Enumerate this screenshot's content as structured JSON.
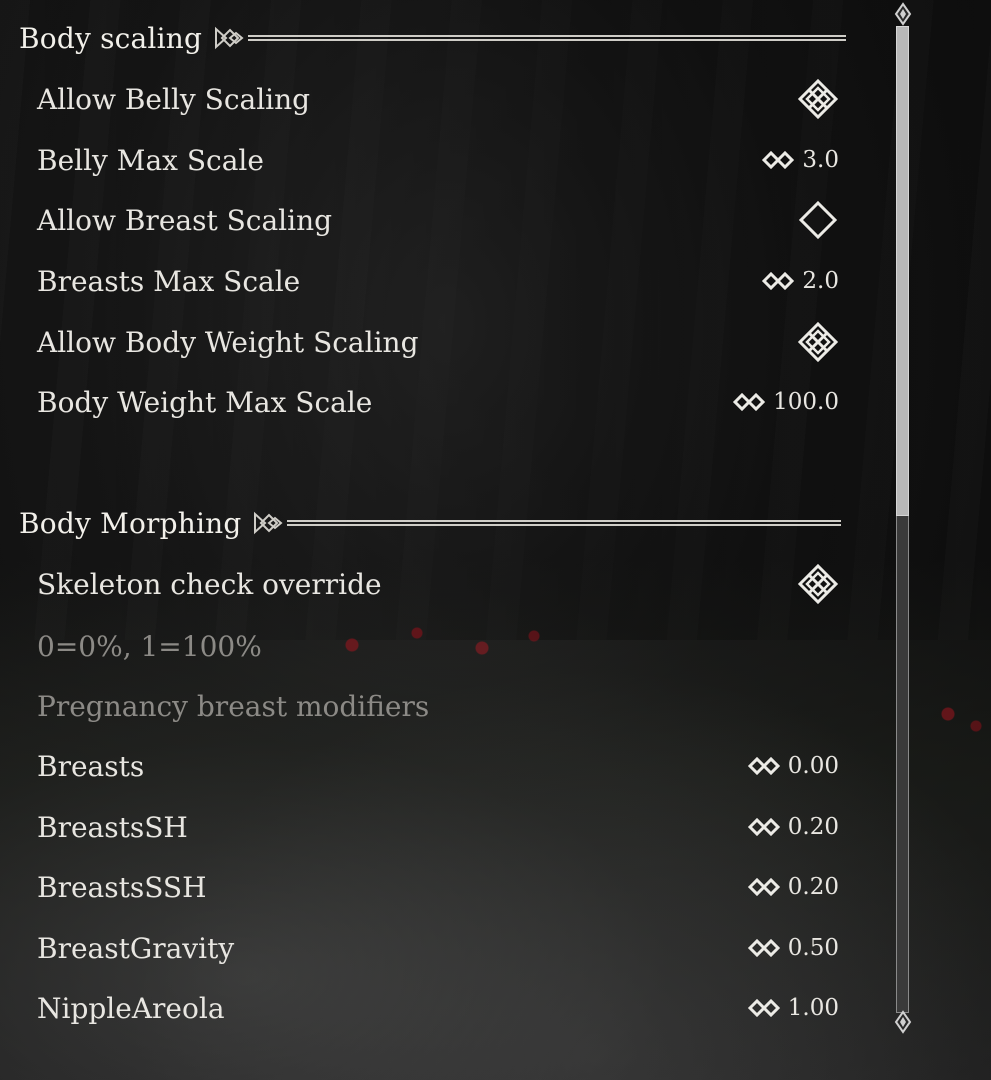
{
  "sections": [
    {
      "title": "Body scaling",
      "rows": [
        {
          "label": "Allow Belly Scaling",
          "type": "toggle",
          "checked": true
        },
        {
          "label": "Belly Max Scale",
          "type": "slider",
          "value": "3.0"
        },
        {
          "label": "Allow Breast Scaling",
          "type": "toggle",
          "checked": false
        },
        {
          "label": "Breasts Max Scale",
          "type": "slider",
          "value": "2.0"
        },
        {
          "label": "Allow Body Weight Scaling",
          "type": "toggle",
          "checked": true
        },
        {
          "label": "Body Weight Max Scale",
          "type": "slider",
          "value": "100.0"
        }
      ]
    },
    {
      "title": "Body Morphing",
      "rows": [
        {
          "label": "Skeleton check override",
          "type": "toggle",
          "checked": true
        },
        {
          "label": "0=0%, 1=100%",
          "type": "text",
          "disabled": true
        },
        {
          "label": "Pregnancy breast modifiers",
          "type": "text",
          "disabled": true
        },
        {
          "label": "Breasts",
          "type": "slider",
          "value": "0.00"
        },
        {
          "label": "BreastsSH",
          "type": "slider",
          "value": "0.20"
        },
        {
          "label": "BreastsSSH",
          "type": "slider",
          "value": "0.20"
        },
        {
          "label": "BreastGravity",
          "type": "slider",
          "value": "0.50"
        },
        {
          "label": "NippleAreola",
          "type": "slider",
          "value": "1.00"
        }
      ]
    }
  ],
  "scrollbar": {
    "position": 0.0,
    "visible_fraction": 0.5
  },
  "icons": {
    "toggle_on": "checked-diamond-icon",
    "toggle_off": "empty-diamond-icon",
    "slider": "slider-arrows-icon",
    "header_ornament": "ornament-icon",
    "scroll_up": "scroll-up-arrow-icon",
    "scroll_down": "scroll-down-arrow-icon"
  },
  "colors": {
    "text": "#e8e6e1",
    "text_disabled": "#8c8a86",
    "line": "#cfcdc7"
  }
}
